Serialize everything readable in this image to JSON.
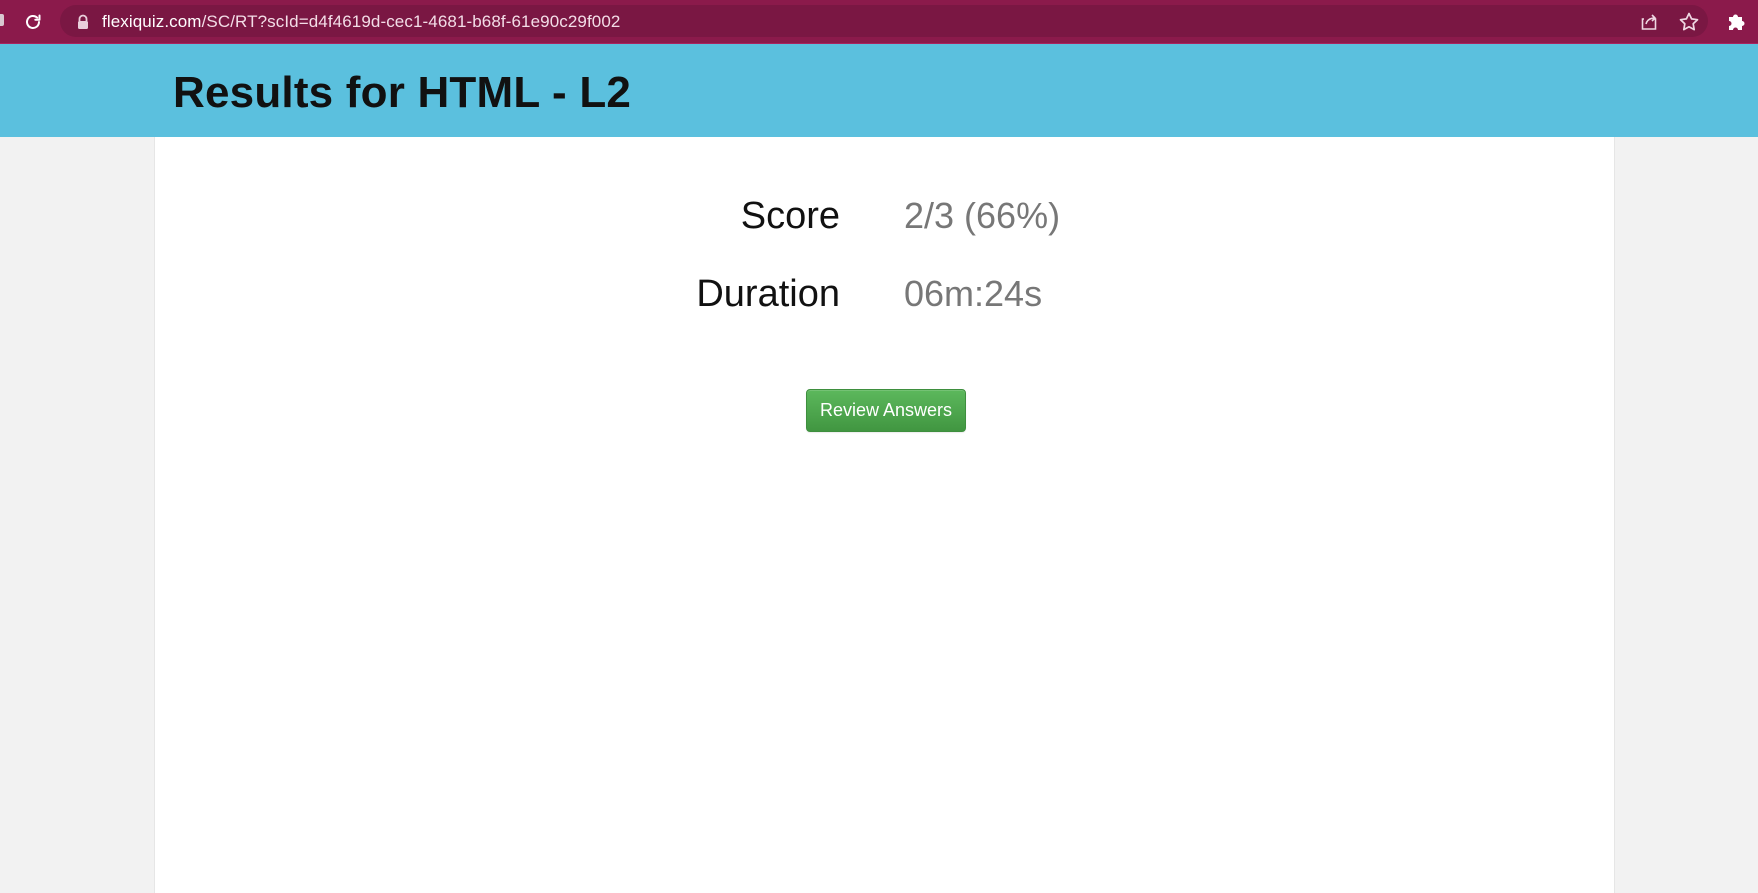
{
  "browser": {
    "url_host": "flexiquiz.com",
    "url_path": "/SC/RT?scId=d4f4619d-cec1-4681-b68f-61e90c29f002",
    "icons": [
      "reload-icon",
      "lock-icon",
      "share-icon",
      "star-icon",
      "extensions-puzzle-icon"
    ],
    "colors": {
      "frame": "#8b1a4b",
      "omnibox": "#7a1743"
    }
  },
  "header": {
    "title": "Results for HTML - L2",
    "background": "#5bc0de"
  },
  "results": {
    "score_label": "Score",
    "score_value": "2/3 (66%)",
    "duration_label": "Duration",
    "duration_value": "06m:24s"
  },
  "actions": {
    "review_label": "Review Answers",
    "review_color": "#5cb85c"
  }
}
